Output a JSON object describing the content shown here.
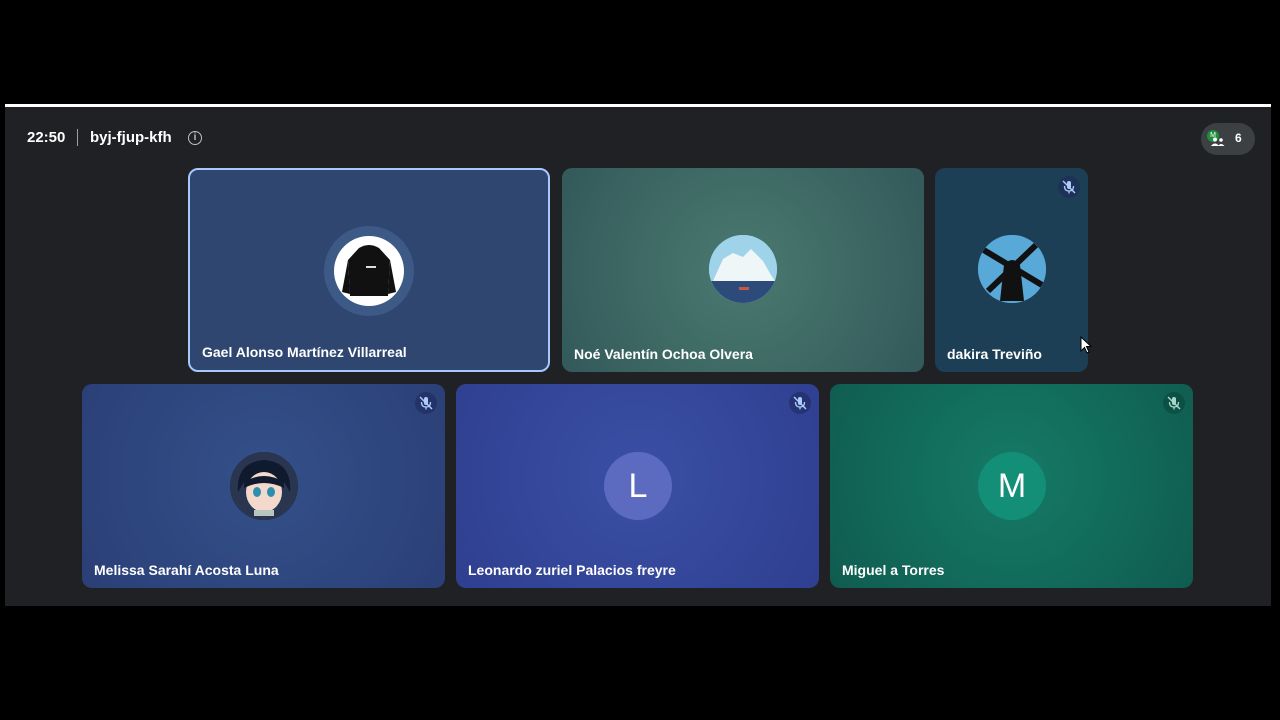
{
  "meeting": {
    "time": "22:50",
    "code": "byj-fjup-kfh",
    "participant_count": "6",
    "count_avatar_letter": "M"
  },
  "tiles": [
    {
      "name": "Gael Alonso Martínez Villarreal",
      "avatar": "hoodie-image",
      "muted": false,
      "active_speaker": true
    },
    {
      "name": "Noé Valentín Ochoa Olvera",
      "avatar": "iceberg-image",
      "muted": false
    },
    {
      "name": "dakira Treviño",
      "avatar": "windmill-image",
      "muted": true
    },
    {
      "name": "Melissa Sarahí Acosta Luna",
      "avatar": "anime-character-image",
      "muted": true
    },
    {
      "name": "Leonardo zuriel Palacios freyre",
      "avatar_letter": "L",
      "muted": true
    },
    {
      "name": "Miguel a Torres",
      "avatar_letter": "M",
      "muted": true
    }
  ],
  "colors": {
    "tile1": "#2e4670",
    "tile2": "#3a6660",
    "tile3": "#1e4258",
    "tile4": "#2d4580",
    "tile5": "#33459a",
    "tile6": "#13685a",
    "avatar_L": "#5c6bc0",
    "avatar_M": "#138f78"
  }
}
